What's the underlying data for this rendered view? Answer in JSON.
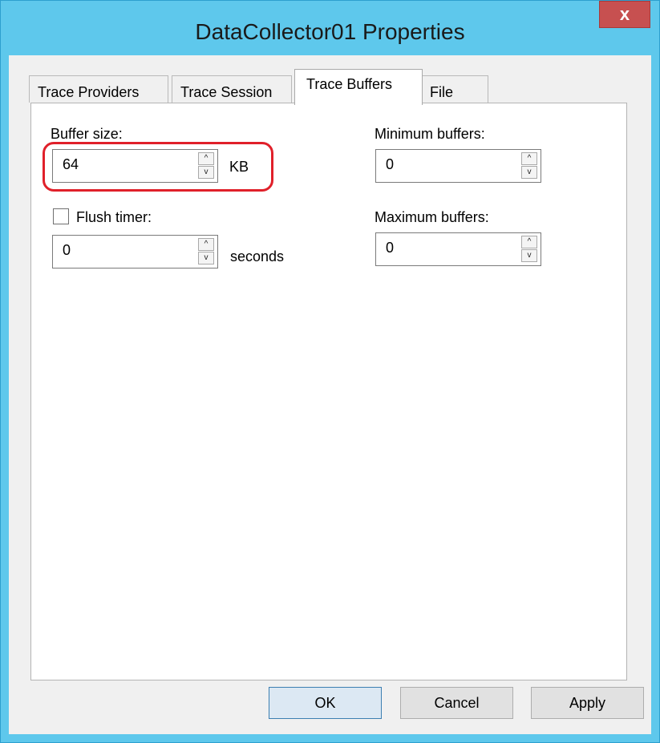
{
  "window": {
    "title": "DataCollector01 Properties",
    "close_label": "x"
  },
  "tabs": [
    {
      "label": "Trace Providers",
      "active": false
    },
    {
      "label": "Trace Session",
      "active": false
    },
    {
      "label": "Trace Buffers",
      "active": true
    },
    {
      "label": "File",
      "active": false
    }
  ],
  "fields": {
    "buffer_size": {
      "label": "Buffer size:",
      "value": "64",
      "unit": "KB",
      "highlighted": true
    },
    "flush_timer": {
      "label": "Flush timer:",
      "checked": false,
      "value": "0",
      "unit": "seconds"
    },
    "minimum_buffers": {
      "label": "Minimum buffers:",
      "value": "0"
    },
    "maximum_buffers": {
      "label": "Maximum buffers:",
      "value": "0"
    }
  },
  "spin_glyphs": {
    "up": "^",
    "down": "v"
  },
  "buttons": {
    "ok": "OK",
    "cancel": "Cancel",
    "apply": "Apply"
  },
  "colors": {
    "titlebar": "#5ec8ec",
    "close": "#c75050",
    "highlight": "#e0202a"
  }
}
